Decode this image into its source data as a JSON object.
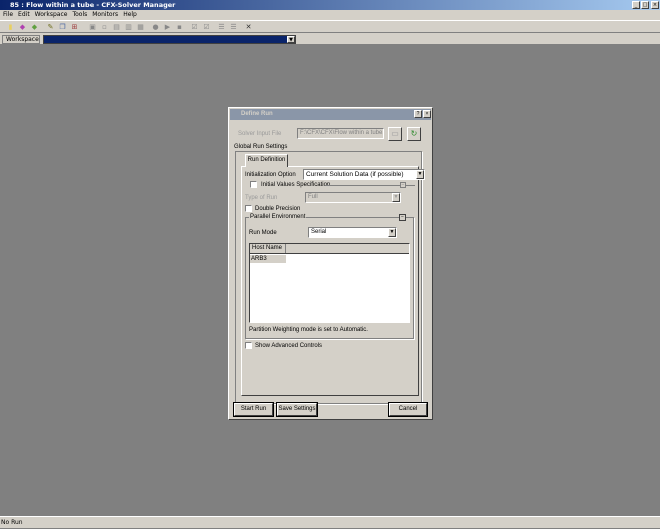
{
  "window": {
    "title": "85 : Flow within a tube - CFX-Solver Manager",
    "controls": [
      "_",
      "□",
      "×"
    ]
  },
  "menu": [
    "File",
    "Edit",
    "Workspace",
    "Tools",
    "Monitors",
    "Help"
  ],
  "toolbar": [
    "new-icon",
    "open-icon",
    "recent-icon",
    "edit-icon",
    "copy-icon",
    "tree-icon",
    "t1",
    "t2",
    "t3",
    "t4",
    "t5",
    "globe-icon",
    "play-icon",
    "save-icon",
    "check-icon",
    "check2-icon",
    "list-icon",
    "list2-icon",
    "close-icon"
  ],
  "workspace": {
    "label": "Workspace",
    "value": ""
  },
  "status": "No Run",
  "dialog": {
    "title": "Define Run",
    "help": "?",
    "close": "×",
    "solver_input_label": "Solver Input File",
    "solver_input_value": "F:\\CFX\\CFX\\Flow within a tube.def",
    "global_label": "Global Run Settings",
    "tab": "Run Definition",
    "init_label": "Initialization Option",
    "init_value": "Current Solution Data (if possible)",
    "initial_values_label": "Initial Values Specification",
    "type_label": "Type of Run",
    "type_value": "Full",
    "double_label": "Double Precision",
    "parallel_label": "Parallel Environment",
    "run_mode_label": "Run Mode",
    "run_mode_value": "Serial",
    "table_header": "Host Name",
    "hosts": [
      "ARB3"
    ],
    "partition_note": "Partition Weighting mode is set to Automatic.",
    "advanced_label": "Show Advanced Controls",
    "start": "Start Run",
    "save": "Save Settings",
    "cancel": "Cancel"
  }
}
